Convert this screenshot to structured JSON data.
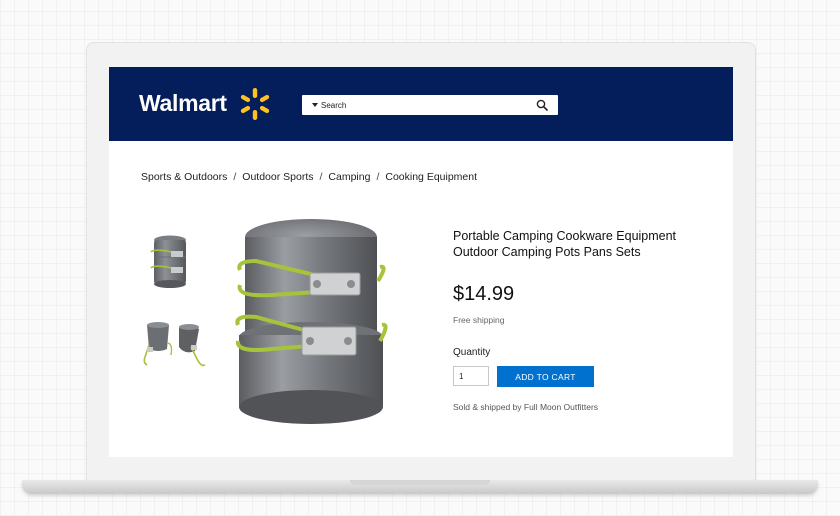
{
  "brand": {
    "name": "Walmart",
    "accent": "#ffc220",
    "header_bg": "#041e5b"
  },
  "search": {
    "placeholder": "Search",
    "icon": "search-icon",
    "dropdown_icon": "caret-down-icon"
  },
  "breadcrumb": [
    "Sports & Outdoors",
    "Outdoor Sports",
    "Camping",
    "Cooking Equipment"
  ],
  "gallery": {
    "thumbnails": [
      "cookware-stacked-thumbnail",
      "cups-with-handles-thumbnail"
    ],
    "main": "cookware-pot-main-image"
  },
  "product": {
    "title_line1": "Portable Camping Cookware Equipment",
    "title_line2": "Outdoor Camping Pots Pans Sets",
    "price": "$14.99",
    "shipping": "Free shipping",
    "quantity_label": "Quantity",
    "quantity_value": "1",
    "add_to_cart": "ADD TO CART",
    "seller": "Sold & shipped by Full Moon Outfitters",
    "button_color": "#0071ce"
  }
}
